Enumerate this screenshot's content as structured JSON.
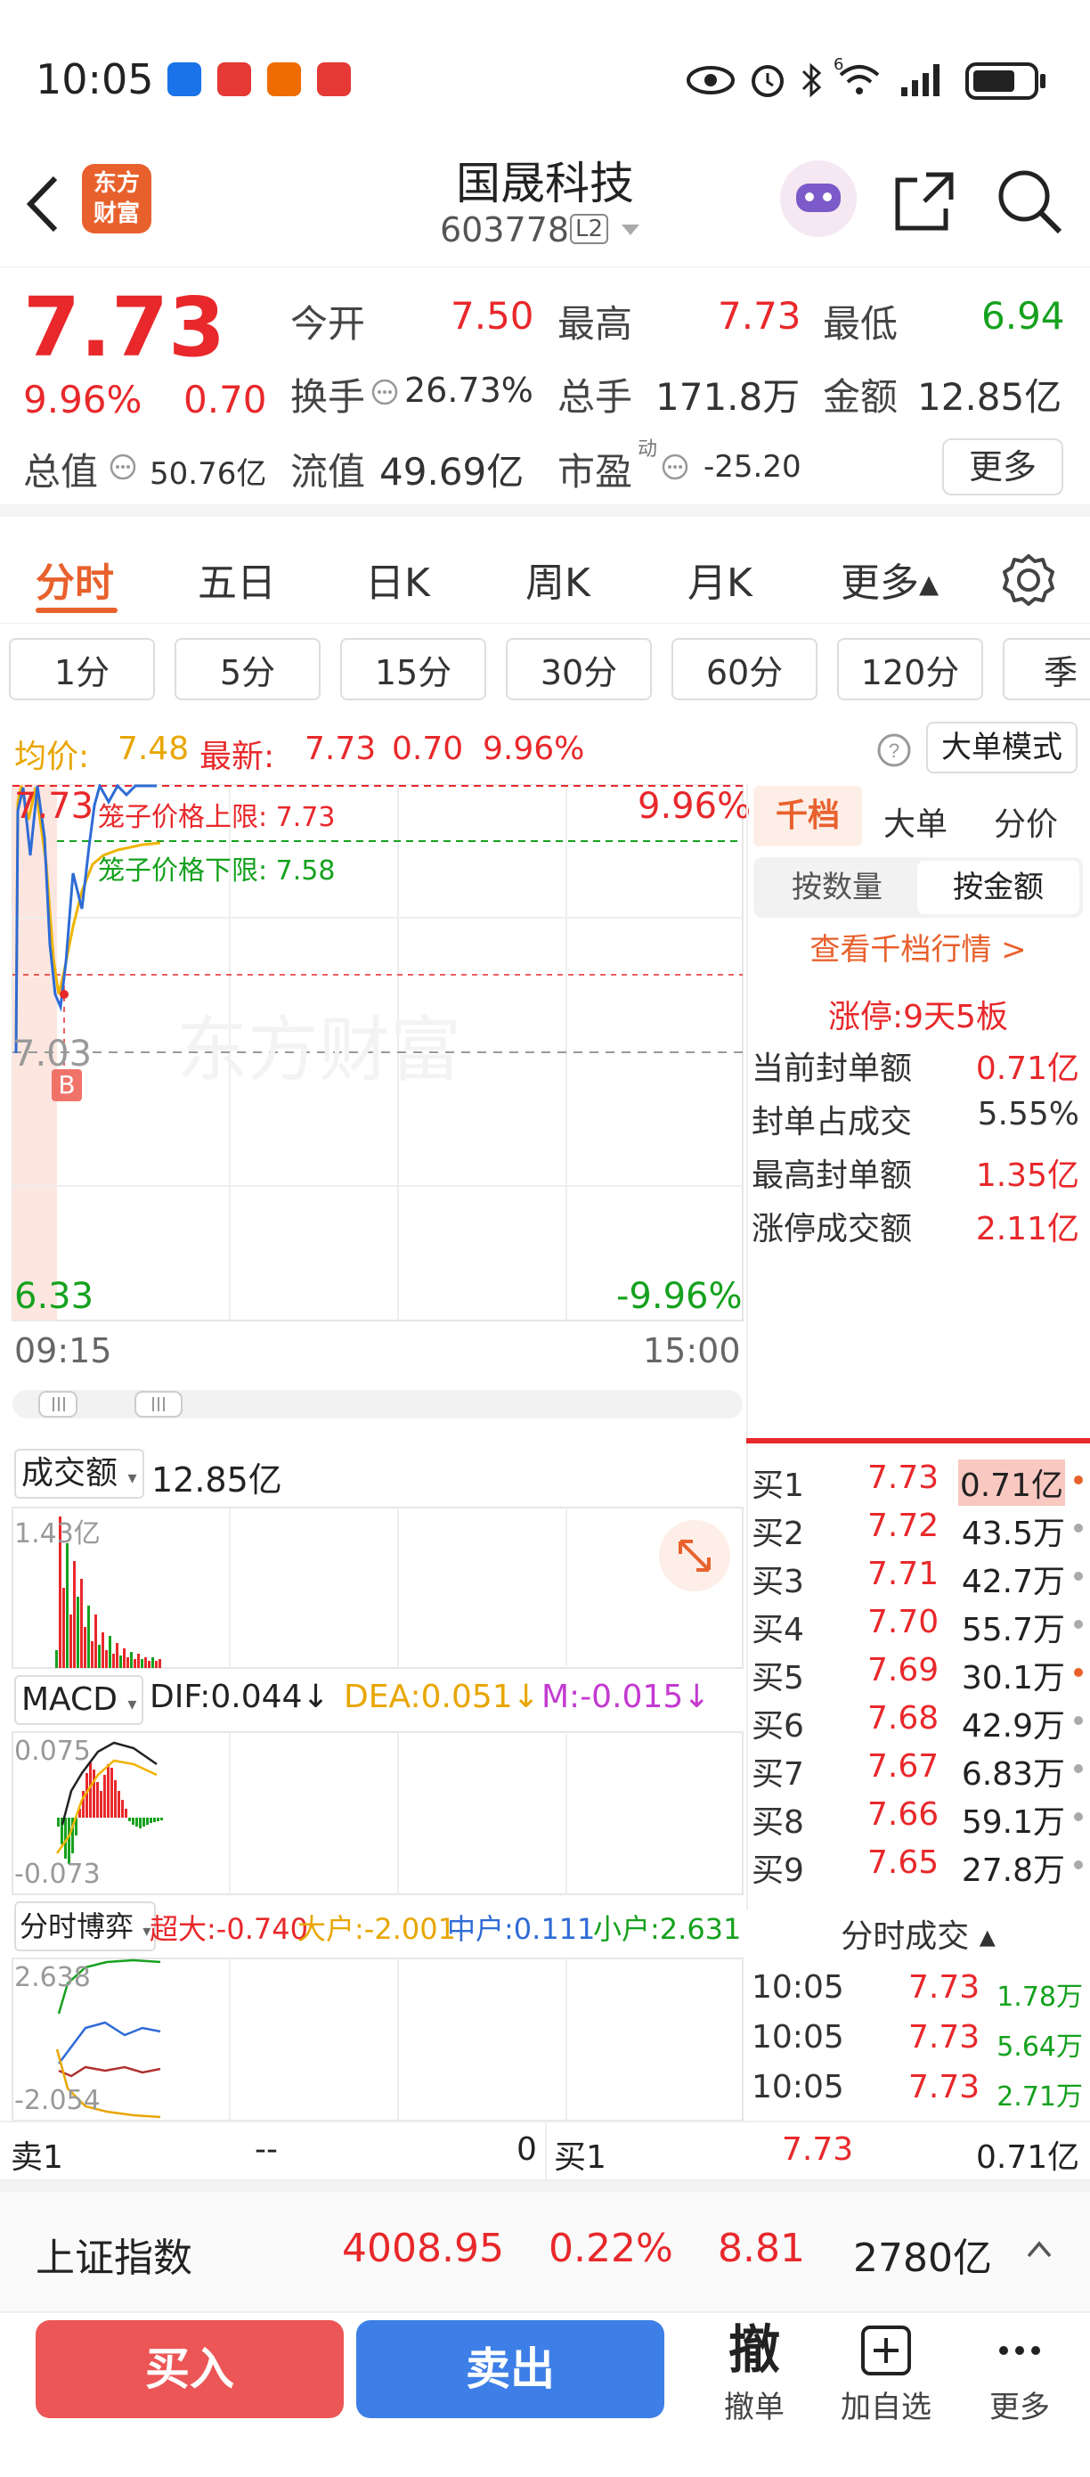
{
  "status": {
    "time": "10:05",
    "signal_badge": "6"
  },
  "header": {
    "title": "国晟科技",
    "code": "603778",
    "level_badge": "L2",
    "logo_text_1": "东方",
    "logo_text_2": "财富"
  },
  "quote": {
    "price": "7.73",
    "change_pct": "9.96%",
    "change": "0.70",
    "open_label": "今开",
    "open": "7.50",
    "high_label": "最高",
    "high": "7.73",
    "low_label": "最低",
    "low": "6.94",
    "turnover_label": "换手",
    "turnover": "26.73%",
    "volume_label": "总手",
    "volume": "171.8万",
    "amount_label": "金额",
    "amount": "12.85亿",
    "total_mv_label": "总值",
    "total_mv": "50.76亿",
    "float_mv_label": "流值",
    "float_mv": "49.69亿",
    "pe_label": "市盈",
    "pe_sup": "动",
    "pe": "-25.20",
    "more_label": "更多"
  },
  "chart_tabs": [
    {
      "label": "分时",
      "active": true
    },
    {
      "label": "五日"
    },
    {
      "label": "日K"
    },
    {
      "label": "周K"
    },
    {
      "label": "月K"
    },
    {
      "label": "更多▴"
    }
  ],
  "periods": [
    "1分",
    "5分",
    "15分",
    "30分",
    "60分",
    "120分",
    "季"
  ],
  "summary": {
    "avg_label": "均价:",
    "avg": "7.48",
    "latest_label": "最新:",
    "latest": "7.73",
    "change": "0.70",
    "change_pct": "9.96%",
    "big_order_label": "大单模式"
  },
  "main_chart": {
    "top_price": "7.73",
    "top_pct": "9.96%",
    "mid_price": "7.03",
    "bottom_price": "6.33",
    "bottom_pct": "-9.96%",
    "upper_limit_label": "笼子价格上限:",
    "upper_limit": "7.73",
    "lower_limit_label": "笼子价格下限:",
    "lower_limit": "7.58",
    "watermark": "东方财富",
    "buy_marker": "B",
    "time_start": "09:15",
    "time_end": "15:00"
  },
  "volume_panel": {
    "label": "成交额",
    "value": "12.85亿",
    "max": "1.43亿"
  },
  "macd_panel": {
    "label": "MACD",
    "dif": "DIF:0.044↓",
    "dea": "DEA:0.051↓",
    "m": "M:-0.015↓",
    "max": "0.075",
    "min": "-0.073"
  },
  "flow_panel": {
    "label": "分时博弈",
    "super": "超大:-0.740",
    "big": "大户:-2.001",
    "mid": "中户:0.111",
    "small": "小户:2.631",
    "max": "2.638",
    "min": "-2.054"
  },
  "depth_tabs": {
    "thousand": "千档",
    "big": "大单",
    "price": "分价",
    "by_qty": "按数量",
    "by_amount": "按金额",
    "view_link": "查看千档行情 >"
  },
  "limit_up": {
    "title": "涨停:9天5板",
    "rows": [
      {
        "label": "当前封单额",
        "value": "0.71亿"
      },
      {
        "label": "封单占成交",
        "value": "5.55%"
      },
      {
        "label": "最高封单额",
        "value": "1.35亿"
      },
      {
        "label": "涨停成交额",
        "value": "2.11亿"
      }
    ]
  },
  "bids": [
    {
      "label": "买1",
      "price": "7.73",
      "amount": "0.71亿"
    },
    {
      "label": "买2",
      "price": "7.72",
      "amount": "43.5万"
    },
    {
      "label": "买3",
      "price": "7.71",
      "amount": "42.7万"
    },
    {
      "label": "买4",
      "price": "7.70",
      "amount": "55.7万"
    },
    {
      "label": "买5",
      "price": "7.69",
      "amount": "30.1万"
    },
    {
      "label": "买6",
      "price": "7.68",
      "amount": "42.9万"
    },
    {
      "label": "买7",
      "price": "7.67",
      "amount": "6.83万"
    },
    {
      "label": "买8",
      "price": "7.66",
      "amount": "59.1万"
    },
    {
      "label": "买9",
      "price": "7.65",
      "amount": "27.8万"
    }
  ],
  "trades": {
    "title": "分时成交",
    "rows": [
      {
        "time": "10:05",
        "price": "7.73",
        "vol": "1.78万"
      },
      {
        "time": "10:05",
        "price": "7.73",
        "vol": "5.64万"
      },
      {
        "time": "10:05",
        "price": "7.73",
        "vol": "2.71万"
      }
    ]
  },
  "bottom_quote": {
    "sell_label": "卖1",
    "sell_price": "--",
    "sell_vol": "0",
    "buy_label": "买1",
    "buy_price": "7.73",
    "buy_vol": "0.71亿"
  },
  "index_bar": {
    "name": "上证指数",
    "value": "4008.95",
    "pct": "0.22%",
    "change": "8.81",
    "amount": "2780亿"
  },
  "actions": {
    "buy": "买入",
    "sell": "卖出",
    "cancel_icon": "撤",
    "cancel": "撤单",
    "add_watch": "加自选",
    "more": "更多"
  },
  "colors": {
    "up": "#e8282b",
    "down": "#15a11e",
    "accent": "#e8612d",
    "buy_btn": "#ec5656",
    "sell_btn": "#3d7fe6",
    "price_line": "#2e6bd6",
    "avg_line": "#f0b400"
  }
}
